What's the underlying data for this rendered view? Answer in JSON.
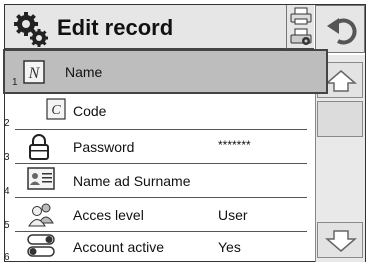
{
  "header": {
    "title": "Edit record"
  },
  "rows": [
    {
      "num": "1",
      "label": "Name",
      "value": "",
      "icon": "name-icon"
    },
    {
      "num": "2",
      "label": "Code",
      "value": "",
      "icon": "code-icon"
    },
    {
      "num": "3",
      "label": "Password",
      "value": "*******",
      "icon": "padlock-icon"
    },
    {
      "num": "4",
      "label": "Name ad Surname",
      "value": "",
      "icon": "id-card-icon"
    },
    {
      "num": "5",
      "label": "Acces level",
      "value": "User",
      "icon": "users-icon"
    },
    {
      "num": "6",
      "label": "Account active",
      "value": "Yes",
      "icon": "toggle-icon"
    }
  ],
  "colors": {
    "header_bg": "#e6e6e6",
    "selected_bg": "#bdbdbd",
    "border": "#444444"
  }
}
